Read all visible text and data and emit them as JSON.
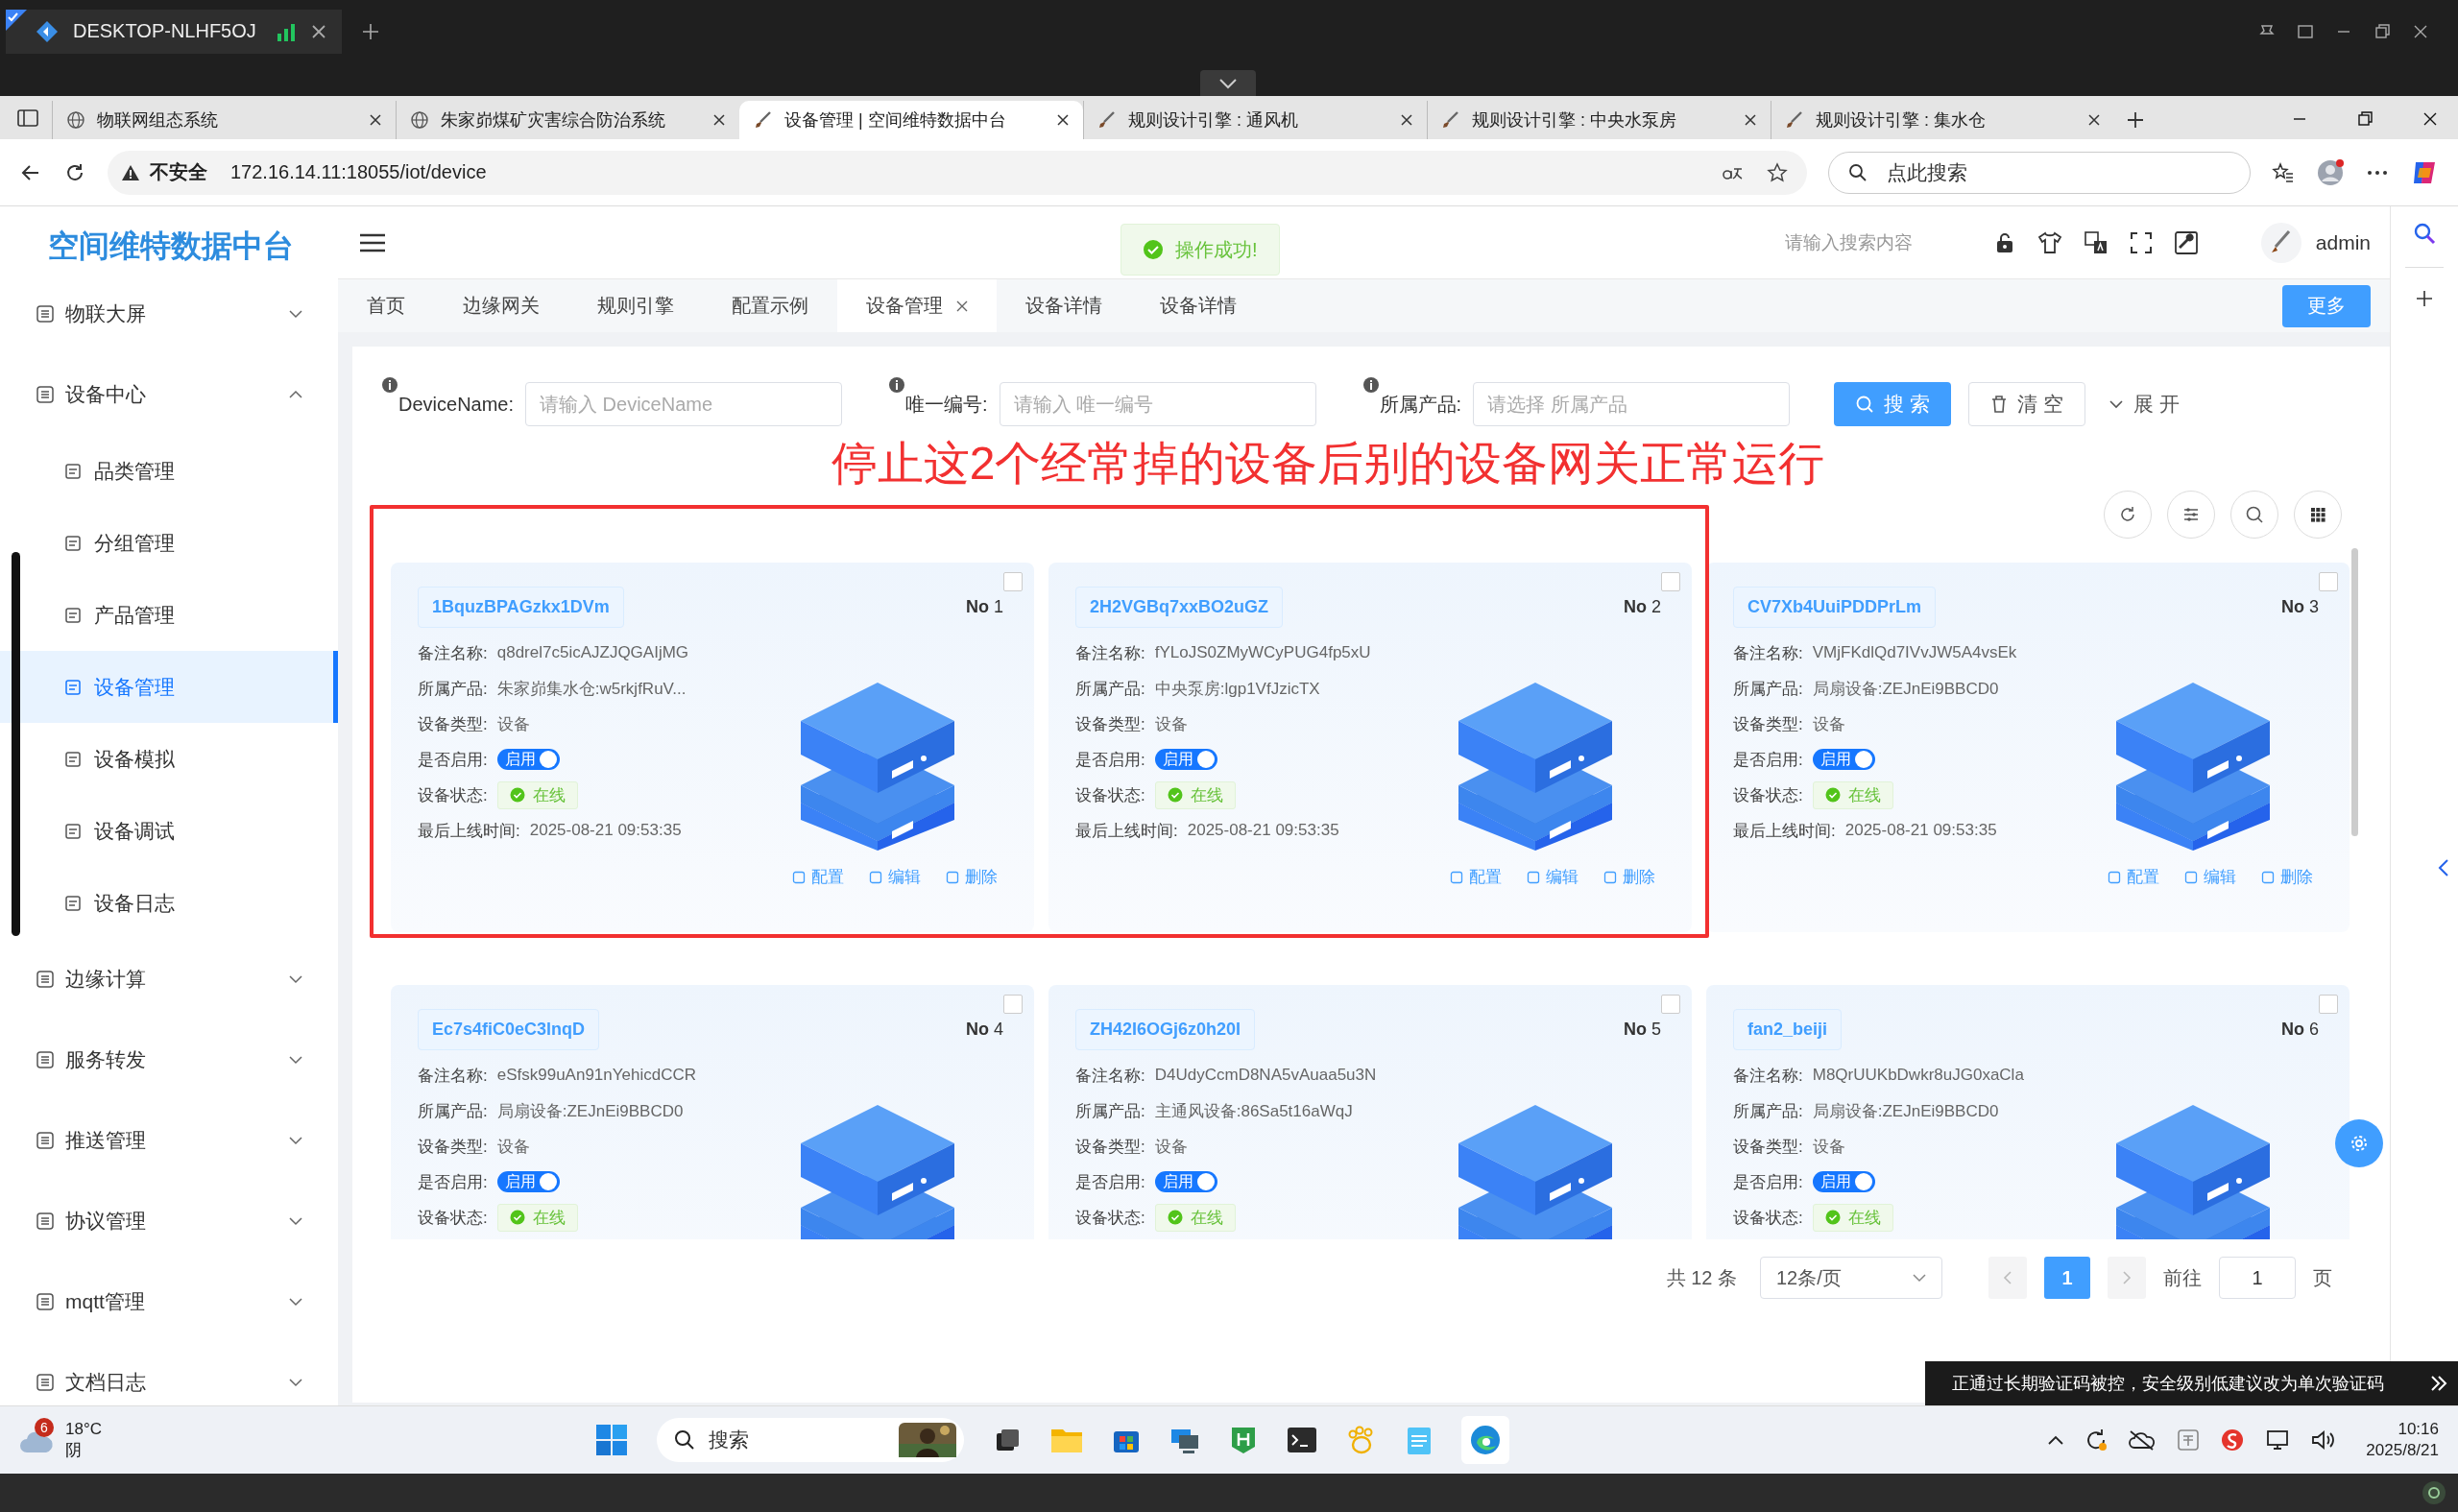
{
  "remote_session": {
    "title": "DESKTOP-NLHF5OJ"
  },
  "browser_tabs": [
    {
      "title": "物联网组态系统",
      "selected": false,
      "kind": "globe"
    },
    {
      "title": "朱家峁煤矿灾害综合防治系统",
      "selected": false,
      "kind": "globe"
    },
    {
      "title": "设备管理 | 空间维特数据中台",
      "selected": true,
      "kind": "brush"
    },
    {
      "title": "规则设计引擎 : 通风机",
      "selected": false,
      "kind": "brush"
    },
    {
      "title": "规则设计引擎 : 中央水泵房",
      "selected": false,
      "kind": "brush"
    },
    {
      "title": "规则设计引擎 : 集水仓",
      "selected": false,
      "kind": "brush"
    }
  ],
  "address_bar": {
    "security": "不安全",
    "url": "172.16.14.11:18055/iot/device",
    "search_placeholder": "点此搜索"
  },
  "sidebar": {
    "logo": "空间维特数据中台",
    "items": [
      {
        "label": "物联大屏",
        "expanded": false
      },
      {
        "label": "设备中心",
        "expanded": true,
        "children": [
          {
            "label": "品类管理",
            "selected": false
          },
          {
            "label": "分组管理",
            "selected": false
          },
          {
            "label": "产品管理",
            "selected": false
          },
          {
            "label": "设备管理",
            "selected": true
          },
          {
            "label": "设备模拟",
            "selected": false
          },
          {
            "label": "设备调试",
            "selected": false
          },
          {
            "label": "设备日志",
            "selected": false
          }
        ]
      },
      {
        "label": "边缘计算",
        "expanded": false
      },
      {
        "label": "服务转发",
        "expanded": false
      },
      {
        "label": "推送管理",
        "expanded": false
      },
      {
        "label": "协议管理",
        "expanded": false
      },
      {
        "label": "mqtt管理",
        "expanded": false
      },
      {
        "label": "文档日志",
        "expanded": false
      }
    ]
  },
  "header": {
    "toast": "操作成功!",
    "search_placeholder": "请输入搜索内容",
    "user": "admin"
  },
  "page_tabs": [
    {
      "label": "首页",
      "selected": false
    },
    {
      "label": "边缘网关",
      "selected": false
    },
    {
      "label": "规则引擎",
      "selected": false
    },
    {
      "label": "配置示例",
      "selected": false
    },
    {
      "label": "设备管理",
      "selected": true
    },
    {
      "label": "设备详情",
      "selected": false
    },
    {
      "label": "设备详情",
      "selected": false
    }
  ],
  "more_button": "更多",
  "filters": [
    {
      "label": "DeviceName:",
      "placeholder": "请输入 DeviceName"
    },
    {
      "label": "唯一编号:",
      "placeholder": "请输入 唯一编号"
    },
    {
      "label": "所属产品:",
      "placeholder": "请选择 所属产品"
    }
  ],
  "search_button": "搜 索",
  "clear_button": "清 空",
  "expand_link": "展 开",
  "annotation": "停止这2个经常掉的设备后别的设备网关正常运行",
  "cards": [
    {
      "name": "1BquzBPAGzkx1DVm",
      "number": "**No** 1",
      "checked": false,
      "highlighted": true,
      "fields": [
        {
          "kind": "text",
          "label": "备注名称:",
          "value": "q8drel7c5icAJZJQGAIjMG"
        },
        {
          "kind": "text",
          "label": "所属产品:",
          "value": "朱家峁集水仓:w5rkjfRuV..."
        },
        {
          "kind": "text",
          "label": "设备类型:",
          "value": "设备"
        },
        {
          "kind": "switch",
          "label": "是否启用:",
          "value": "启用",
          "on": true
        },
        {
          "kind": "status",
          "label": "设备状态:",
          "value": "在线"
        },
        {
          "kind": "text",
          "label": "最后上线时间:",
          "value": "2025-08-21 09:53:35"
        }
      ],
      "actions": [
        "配置",
        "编辑",
        "删除"
      ]
    },
    {
      "name": "2H2VGBq7xxBO2uGZ",
      "number": "**No** 2",
      "checked": false,
      "highlighted": true,
      "fields": [
        {
          "kind": "text",
          "label": "备注名称:",
          "value": "fYLoJS0ZMyWCyPUG4fp5xU"
        },
        {
          "kind": "text",
          "label": "所属产品:",
          "value": "中央泵房:lgp1VfJzicTX"
        },
        {
          "kind": "text",
          "label": "设备类型:",
          "value": "设备"
        },
        {
          "kind": "switch",
          "label": "是否启用:",
          "value": "启用",
          "on": true
        },
        {
          "kind": "status",
          "label": "设备状态:",
          "value": "在线"
        },
        {
          "kind": "text",
          "label": "最后上线时间:",
          "value": "2025-08-21 09:53:35"
        }
      ],
      "actions": [
        "配置",
        "编辑",
        "删除"
      ]
    },
    {
      "name": "CV7Xb4UuiPDDPrLm",
      "number": "**No** 3",
      "checked": false,
      "highlighted": false,
      "fields": [
        {
          "kind": "text",
          "label": "备注名称:",
          "value": "VMjFKdlQd7IVvJW5A4vsEk"
        },
        {
          "kind": "text",
          "label": "所属产品:",
          "value": "局扇设备:ZEJnEi9BBCD0"
        },
        {
          "kind": "text",
          "label": "设备类型:",
          "value": "设备"
        },
        {
          "kind": "switch",
          "label": "是否启用:",
          "value": "启用",
          "on": true
        },
        {
          "kind": "status",
          "label": "设备状态:",
          "value": "在线"
        },
        {
          "kind": "text",
          "label": "最后上线时间:",
          "value": "2025-08-21 09:53:35"
        }
      ],
      "actions": [
        "配置",
        "编辑",
        "删除"
      ]
    },
    {
      "name": "Ec7s4fiC0eC3lnqD",
      "number": "**No** 4",
      "checked": false,
      "highlighted": false,
      "fields": [
        {
          "kind": "text",
          "label": "备注名称:",
          "value": "eSfsk99uAn91nYehicdCCR"
        },
        {
          "kind": "text",
          "label": "所属产品:",
          "value": "局扇设备:ZEJnEi9BBCD0"
        },
        {
          "kind": "text",
          "label": "设备类型:",
          "value": "设备"
        },
        {
          "kind": "switch",
          "label": "是否启用:",
          "value": "启用",
          "on": true
        },
        {
          "kind": "status",
          "label": "设备状态:",
          "value": "在线"
        }
      ]
    },
    {
      "name": "ZH42I6OGj6z0h20I",
      "number": "**No** 5",
      "checked": false,
      "highlighted": false,
      "fields": [
        {
          "kind": "text",
          "label": "备注名称:",
          "value": "D4UdyCcmD8NA5vAuaa5u3N"
        },
        {
          "kind": "text",
          "label": "所属产品:",
          "value": "主通风设备:86Sa5t16aWqJ"
        },
        {
          "kind": "text",
          "label": "设备类型:",
          "value": "设备"
        },
        {
          "kind": "switch",
          "label": "是否启用:",
          "value": "启用",
          "on": true
        },
        {
          "kind": "status",
          "label": "设备状态:",
          "value": "在线"
        }
      ]
    },
    {
      "name": "fan2_beiji",
      "number": "**No** 6",
      "checked": false,
      "highlighted": false,
      "fields": [
        {
          "kind": "text",
          "label": "备注名称:",
          "value": "M8QrUUKbDwkr8uJG0xaCla"
        },
        {
          "kind": "text",
          "label": "所属产品:",
          "value": "局扇设备:ZEJnEi9BBCD0"
        },
        {
          "kind": "text",
          "label": "设备类型:",
          "value": "设备"
        },
        {
          "kind": "switch",
          "label": "是否启用:",
          "value": "启用",
          "on": true
        },
        {
          "kind": "status",
          "label": "设备状态:",
          "value": "在线"
        }
      ]
    }
  ],
  "pagination": {
    "total": "共 12 条",
    "page_size": "12条/页",
    "pages": [
      {
        "label": "1",
        "selected": true
      }
    ],
    "goto_label": "前往",
    "goto_value": "1",
    "page_unit": "页"
  },
  "notification": "正通过长期验证码被控，安全级别低建议改为单次验证码",
  "taskbar": {
    "weather_badge": "6",
    "temperature": "18°C",
    "weather": "阴",
    "search": "搜索",
    "time": "10:16",
    "date": "2025/8/21"
  }
}
